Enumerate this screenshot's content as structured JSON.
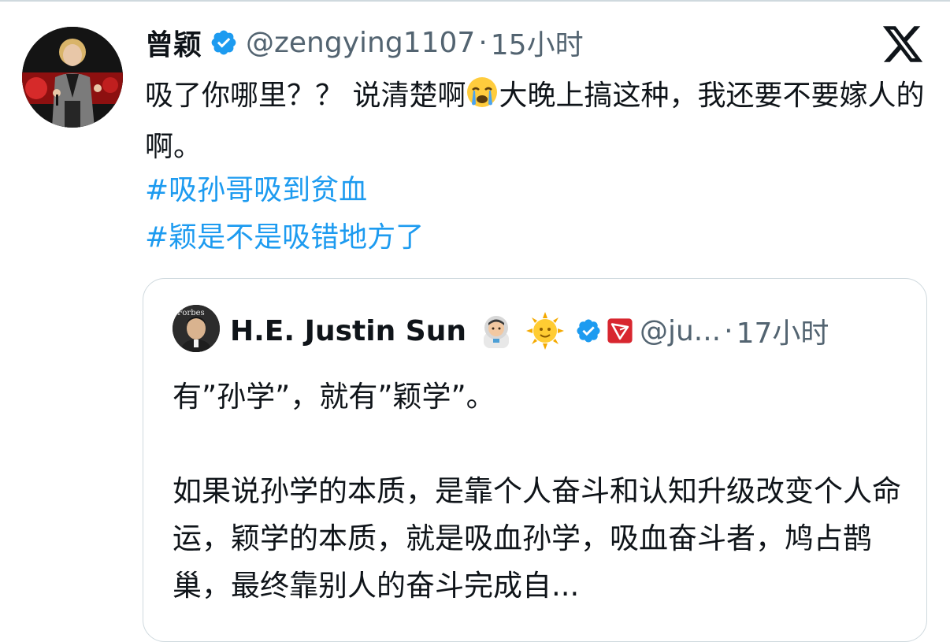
{
  "tweet": {
    "author_name": "曾颖",
    "handle": "@zengying1107",
    "separator": "·",
    "time": "15小时",
    "text_before_emoji": "吸了你哪里？？ 说清楚啊",
    "emoji": "😭",
    "text_after_emoji": "大晚上搞这种，我还要不要嫁人的啊。",
    "hashtags": [
      "#吸孙哥吸到贫血",
      "#颖是不是吸错地方了"
    ]
  },
  "quote": {
    "author_name": "H.E. Justin Sun",
    "handle": "@ju...",
    "separator": "·",
    "time": "17小时",
    "emoji_1": "👨‍🚀",
    "emoji_2": "🌞",
    "line1": "有”孙学”，就有”颖学”。",
    "paragraph": "如果说孙学的本质，是靠个人奋斗和认知升级改变个人命运，颖学的本质，就是吸血孙学，吸血奋斗者，鸠占鹊巢，最终靠别人的奋斗完成自...",
    "avatar_text": "Forbes"
  },
  "icons": {
    "verified_badge": "verified-check-icon",
    "brand": "x-logo-icon",
    "tron": "tron-icon"
  },
  "colors": {
    "link": "#1d9bf0",
    "muted": "#536471",
    "verified": "#1d9bf0",
    "tron_red": "#d8262f"
  }
}
